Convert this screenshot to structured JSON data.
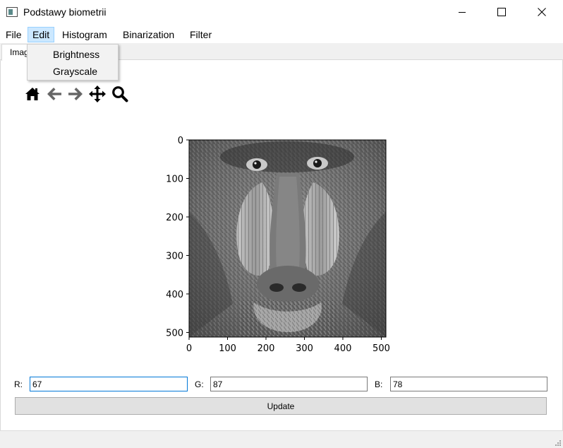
{
  "window": {
    "title": "Podstawy biometrii",
    "icon": "app-window-icon",
    "controls": [
      "minimize-icon",
      "maximize-icon",
      "close-icon"
    ]
  },
  "menubar": {
    "file": "File",
    "edit": "Edit",
    "histogram": "Histogram",
    "binarization": "Binarization",
    "filter": "Filter"
  },
  "edit_menu": {
    "items": [
      "Brightness",
      "Grayscale"
    ]
  },
  "tabs": {
    "active": "Image"
  },
  "toolbar": {
    "icons": [
      "home-icon",
      "back-arrow-icon",
      "forward-arrow-icon",
      "pan-move-icon",
      "zoom-magnifier-icon"
    ]
  },
  "plot": {
    "image": "grayscale mandrill (baboon) face",
    "y_ticks": [
      "0",
      "100",
      "200",
      "300",
      "400",
      "500"
    ],
    "x_ticks": [
      "0",
      "100",
      "200",
      "300",
      "400",
      "500"
    ],
    "xlim": [
      0,
      512
    ],
    "ylim": [
      512,
      0
    ]
  },
  "rgb": {
    "r_label": "R:",
    "g_label": "G:",
    "b_label": "B:",
    "r_value": "67",
    "g_value": "87",
    "b_value": "78"
  },
  "update_label": "Update"
}
